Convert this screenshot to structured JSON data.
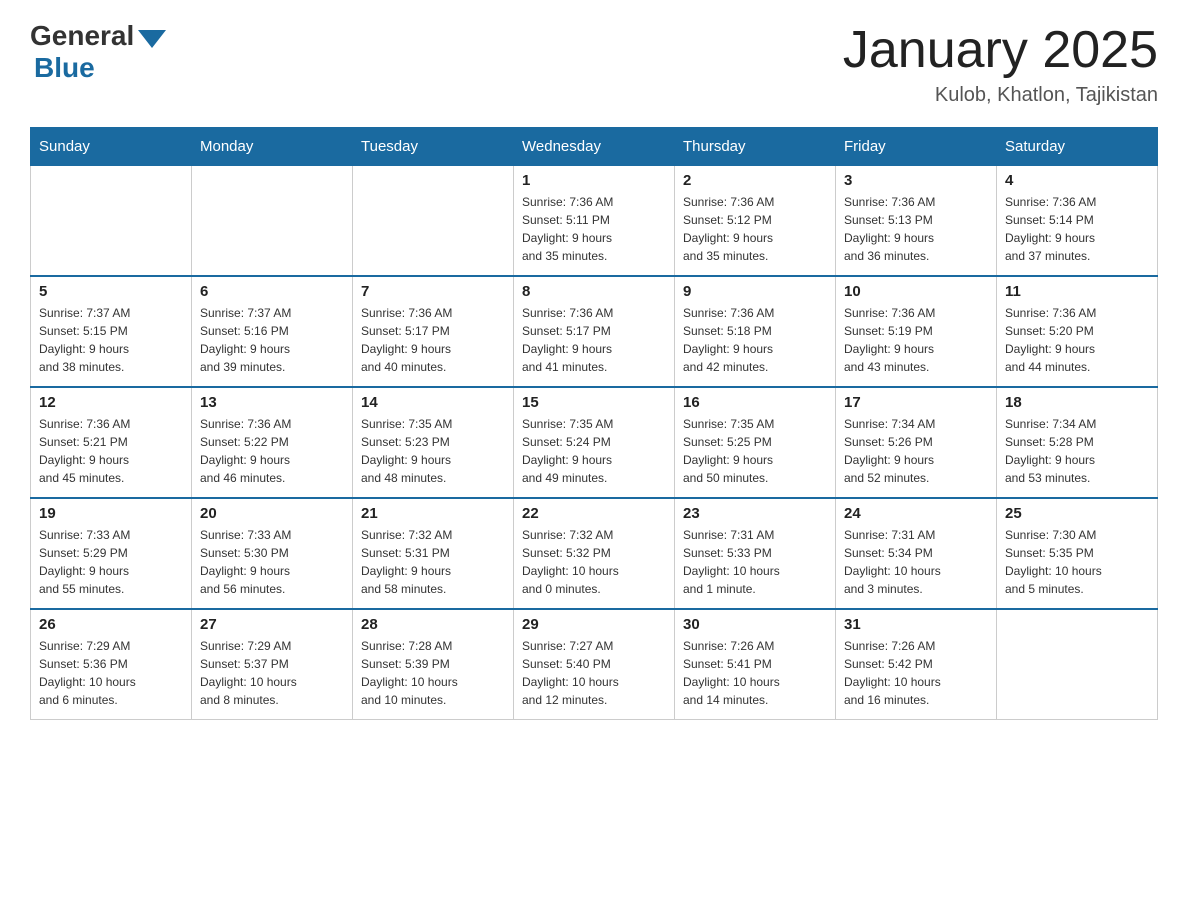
{
  "header": {
    "logo_general": "General",
    "logo_blue": "Blue",
    "title": "January 2025",
    "subtitle": "Kulob, Khatlon, Tajikistan"
  },
  "days_of_week": [
    "Sunday",
    "Monday",
    "Tuesday",
    "Wednesday",
    "Thursday",
    "Friday",
    "Saturday"
  ],
  "weeks": [
    [
      {
        "day": "",
        "info": ""
      },
      {
        "day": "",
        "info": ""
      },
      {
        "day": "",
        "info": ""
      },
      {
        "day": "1",
        "info": "Sunrise: 7:36 AM\nSunset: 5:11 PM\nDaylight: 9 hours\nand 35 minutes."
      },
      {
        "day": "2",
        "info": "Sunrise: 7:36 AM\nSunset: 5:12 PM\nDaylight: 9 hours\nand 35 minutes."
      },
      {
        "day": "3",
        "info": "Sunrise: 7:36 AM\nSunset: 5:13 PM\nDaylight: 9 hours\nand 36 minutes."
      },
      {
        "day": "4",
        "info": "Sunrise: 7:36 AM\nSunset: 5:14 PM\nDaylight: 9 hours\nand 37 minutes."
      }
    ],
    [
      {
        "day": "5",
        "info": "Sunrise: 7:37 AM\nSunset: 5:15 PM\nDaylight: 9 hours\nand 38 minutes."
      },
      {
        "day": "6",
        "info": "Sunrise: 7:37 AM\nSunset: 5:16 PM\nDaylight: 9 hours\nand 39 minutes."
      },
      {
        "day": "7",
        "info": "Sunrise: 7:36 AM\nSunset: 5:17 PM\nDaylight: 9 hours\nand 40 minutes."
      },
      {
        "day": "8",
        "info": "Sunrise: 7:36 AM\nSunset: 5:17 PM\nDaylight: 9 hours\nand 41 minutes."
      },
      {
        "day": "9",
        "info": "Sunrise: 7:36 AM\nSunset: 5:18 PM\nDaylight: 9 hours\nand 42 minutes."
      },
      {
        "day": "10",
        "info": "Sunrise: 7:36 AM\nSunset: 5:19 PM\nDaylight: 9 hours\nand 43 minutes."
      },
      {
        "day": "11",
        "info": "Sunrise: 7:36 AM\nSunset: 5:20 PM\nDaylight: 9 hours\nand 44 minutes."
      }
    ],
    [
      {
        "day": "12",
        "info": "Sunrise: 7:36 AM\nSunset: 5:21 PM\nDaylight: 9 hours\nand 45 minutes."
      },
      {
        "day": "13",
        "info": "Sunrise: 7:36 AM\nSunset: 5:22 PM\nDaylight: 9 hours\nand 46 minutes."
      },
      {
        "day": "14",
        "info": "Sunrise: 7:35 AM\nSunset: 5:23 PM\nDaylight: 9 hours\nand 48 minutes."
      },
      {
        "day": "15",
        "info": "Sunrise: 7:35 AM\nSunset: 5:24 PM\nDaylight: 9 hours\nand 49 minutes."
      },
      {
        "day": "16",
        "info": "Sunrise: 7:35 AM\nSunset: 5:25 PM\nDaylight: 9 hours\nand 50 minutes."
      },
      {
        "day": "17",
        "info": "Sunrise: 7:34 AM\nSunset: 5:26 PM\nDaylight: 9 hours\nand 52 minutes."
      },
      {
        "day": "18",
        "info": "Sunrise: 7:34 AM\nSunset: 5:28 PM\nDaylight: 9 hours\nand 53 minutes."
      }
    ],
    [
      {
        "day": "19",
        "info": "Sunrise: 7:33 AM\nSunset: 5:29 PM\nDaylight: 9 hours\nand 55 minutes."
      },
      {
        "day": "20",
        "info": "Sunrise: 7:33 AM\nSunset: 5:30 PM\nDaylight: 9 hours\nand 56 minutes."
      },
      {
        "day": "21",
        "info": "Sunrise: 7:32 AM\nSunset: 5:31 PM\nDaylight: 9 hours\nand 58 minutes."
      },
      {
        "day": "22",
        "info": "Sunrise: 7:32 AM\nSunset: 5:32 PM\nDaylight: 10 hours\nand 0 minutes."
      },
      {
        "day": "23",
        "info": "Sunrise: 7:31 AM\nSunset: 5:33 PM\nDaylight: 10 hours\nand 1 minute."
      },
      {
        "day": "24",
        "info": "Sunrise: 7:31 AM\nSunset: 5:34 PM\nDaylight: 10 hours\nand 3 minutes."
      },
      {
        "day": "25",
        "info": "Sunrise: 7:30 AM\nSunset: 5:35 PM\nDaylight: 10 hours\nand 5 minutes."
      }
    ],
    [
      {
        "day": "26",
        "info": "Sunrise: 7:29 AM\nSunset: 5:36 PM\nDaylight: 10 hours\nand 6 minutes."
      },
      {
        "day": "27",
        "info": "Sunrise: 7:29 AM\nSunset: 5:37 PM\nDaylight: 10 hours\nand 8 minutes."
      },
      {
        "day": "28",
        "info": "Sunrise: 7:28 AM\nSunset: 5:39 PM\nDaylight: 10 hours\nand 10 minutes."
      },
      {
        "day": "29",
        "info": "Sunrise: 7:27 AM\nSunset: 5:40 PM\nDaylight: 10 hours\nand 12 minutes."
      },
      {
        "day": "30",
        "info": "Sunrise: 7:26 AM\nSunset: 5:41 PM\nDaylight: 10 hours\nand 14 minutes."
      },
      {
        "day": "31",
        "info": "Sunrise: 7:26 AM\nSunset: 5:42 PM\nDaylight: 10 hours\nand 16 minutes."
      },
      {
        "day": "",
        "info": ""
      }
    ]
  ]
}
